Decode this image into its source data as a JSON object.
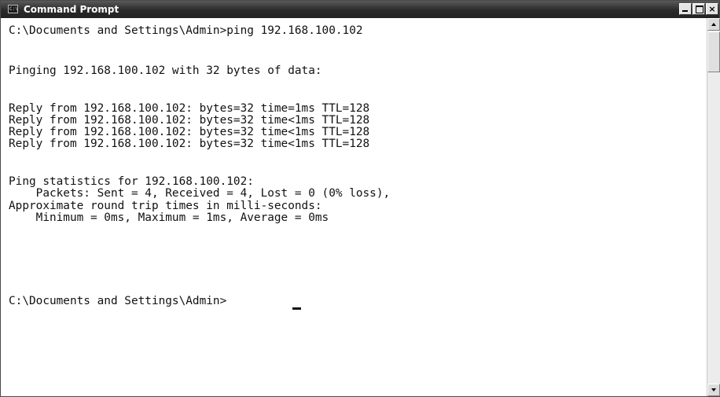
{
  "window": {
    "title": "Command Prompt",
    "icon": "command-prompt-icon",
    "controls": {
      "minimize": "minimize-icon",
      "maximize": "maximize-icon",
      "close": "close-icon"
    }
  },
  "console": {
    "lines": [
      "C:\\Documents and Settings\\Admin>ping 192.168.100.102",
      "Pinging 192.168.100.102 with 32 bytes of data:",
      "Reply from 192.168.100.102: bytes=32 time=1ms TTL=128",
      "Reply from 192.168.100.102: bytes=32 time<1ms TTL=128",
      "Reply from 192.168.100.102: bytes=32 time<1ms TTL=128",
      "Reply from 192.168.100.102: bytes=32 time<1ms TTL=128",
      "Ping statistics for 192.168.100.102:",
      "    Packets: Sent = 4, Received = 4, Lost = 0 (0% loss),",
      "Approximate round trip times in milli-seconds:",
      "    Minimum = 0ms, Maximum = 1ms, Average = 0ms",
      "C:\\Documents and Settings\\Admin>"
    ]
  },
  "colors": {
    "titlebar": "#2a2a2a",
    "console_background": "#ffffff",
    "console_text": "#111111"
  }
}
